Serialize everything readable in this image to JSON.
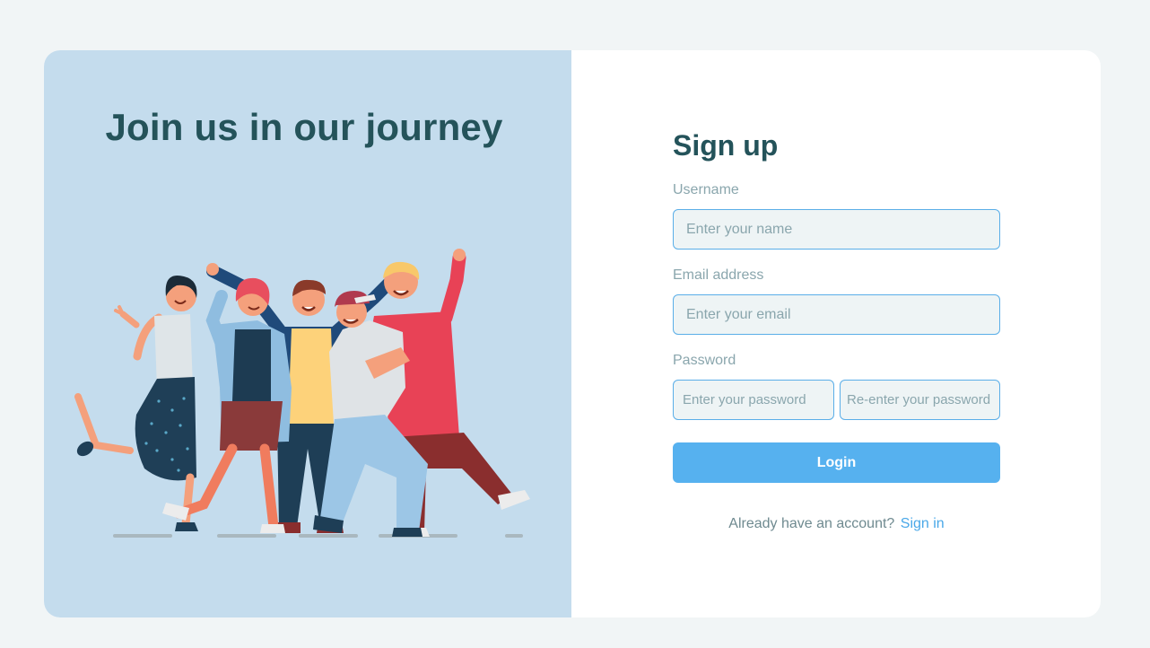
{
  "hero": {
    "title": "Join us in our journey"
  },
  "form": {
    "title": "Sign up",
    "username": {
      "label": "Username",
      "placeholder": "Enter your name"
    },
    "email": {
      "label": "Email address",
      "placeholder": "Enter your email"
    },
    "password": {
      "label": "Password",
      "placeholder": "Enter your password",
      "confirm_placeholder": "Re-enter your password"
    },
    "submit_label": "Login",
    "footer_text": "Already have an account?",
    "footer_link": "Sign in"
  },
  "colors": {
    "background": "#f1f5f6",
    "panel": "#c4dced",
    "heading": "#24535a",
    "accent": "#56b1ef"
  },
  "icons": [
    "group-of-friends-illustration"
  ]
}
